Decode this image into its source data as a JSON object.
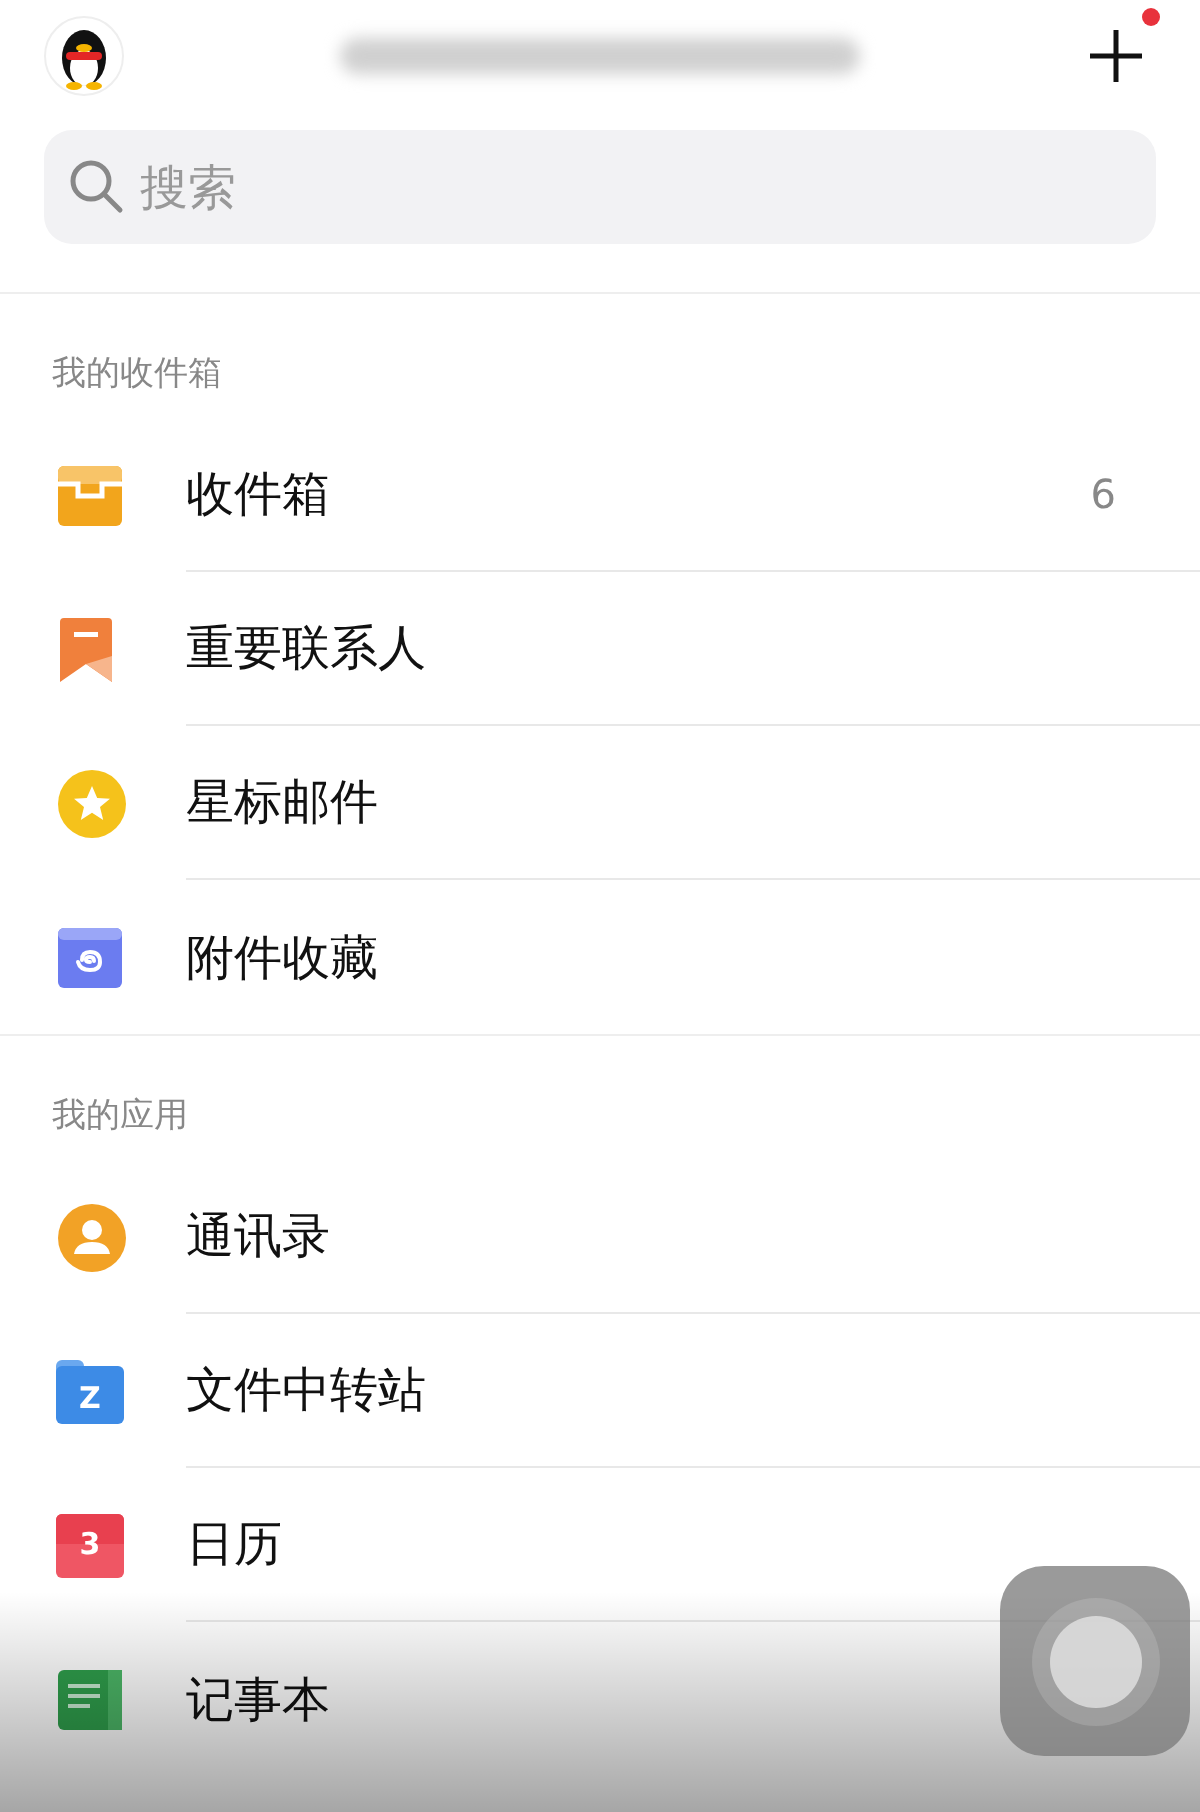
{
  "header": {
    "has_notification": true
  },
  "search": {
    "placeholder": "搜索"
  },
  "sections": [
    {
      "title": "我的收件箱",
      "items": [
        {
          "kind": "inbox",
          "label": "收件箱",
          "count": "6"
        },
        {
          "kind": "bookmark",
          "label": "重要联系人"
        },
        {
          "kind": "star",
          "label": "星标邮件"
        },
        {
          "kind": "attachment",
          "label": "附件收藏"
        }
      ]
    },
    {
      "title": "我的应用",
      "items": [
        {
          "kind": "contacts",
          "label": "通讯录"
        },
        {
          "kind": "folder",
          "label": "文件中转站",
          "icon_text": "Z"
        },
        {
          "kind": "calendar",
          "label": "日历",
          "icon_text": "3"
        },
        {
          "kind": "notes",
          "label": "记事本"
        }
      ]
    }
  ]
}
